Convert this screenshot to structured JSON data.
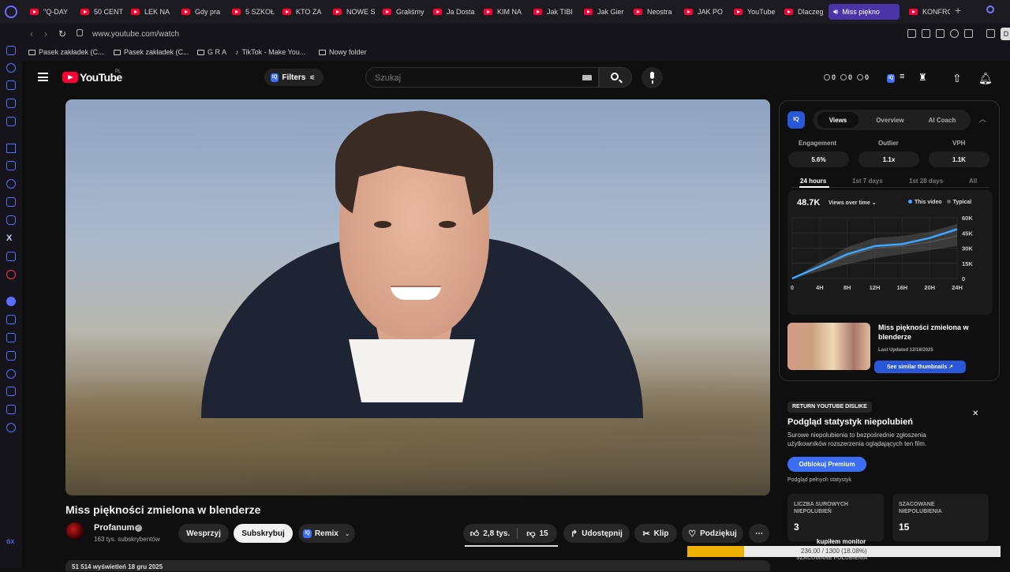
{
  "browser": {
    "tabs": [
      {
        "label": "\"Q-DAY",
        "icon": "youtube-icon"
      },
      {
        "label": "50 CENT",
        "icon": "youtube-icon"
      },
      {
        "label": "LEK NA",
        "icon": "youtube-icon"
      },
      {
        "label": "Gdy pra",
        "icon": "youtube-icon"
      },
      {
        "label": "5 SZKOŁ",
        "icon": "youtube-icon"
      },
      {
        "label": "KTO ZA",
        "icon": "youtube-icon"
      },
      {
        "label": "NOWE S",
        "icon": "youtube-icon"
      },
      {
        "label": "Graliśmy",
        "icon": "youtube-icon"
      },
      {
        "label": "Ja Dosta",
        "icon": "youtube-icon"
      },
      {
        "label": "KIM NA",
        "icon": "youtube-icon"
      },
      {
        "label": "Jak TIBI",
        "icon": "youtube-icon"
      },
      {
        "label": "Jak Gier",
        "icon": "youtube-icon"
      },
      {
        "label": "Neostra",
        "icon": "youtube-icon"
      },
      {
        "label": "JAK PO",
        "icon": "youtube-icon"
      },
      {
        "label": "YouTube",
        "icon": "youtube-icon"
      },
      {
        "label": "Dlaczeg",
        "icon": "youtube-icon"
      },
      {
        "label": "Miss piękno",
        "icon": "speaker-icon",
        "active": true
      },
      {
        "label": "KONFRO",
        "icon": "youtube-icon"
      }
    ],
    "url": "www.youtube.com/watch",
    "profile_initial": "D",
    "bookmarks": [
      {
        "label": "Pasek zakładek (C...",
        "icon": "folder-icon"
      },
      {
        "label": "Pasek zakładek (C...",
        "icon": "folder-icon"
      },
      {
        "label": "G R A",
        "icon": "folder-icon"
      },
      {
        "label": "TikTok - Make You...",
        "icon": "tiktok-icon"
      },
      {
        "label": "Nowy folder",
        "icon": "folder-icon"
      }
    ]
  },
  "header": {
    "logo_text": "YouTube",
    "region": "PL",
    "filters_label": "Filters",
    "search_placeholder": "Szukaj",
    "stats": [
      "0",
      "0",
      "0"
    ]
  },
  "video": {
    "title": "Miss piękności zmielona w blenderze",
    "channel": "Profanum",
    "subscribers": "163 tys. subskrybentów",
    "support_label": "Wesprzyj",
    "subscribe_label": "Subskrybuj",
    "remix_label": "Remix",
    "likes": "2,8 tys.",
    "dislikes": "15",
    "share_label": "Udostępnij",
    "clip_label": "Klip",
    "thanks_label": "Podziękuj",
    "meta": "51 514 wyświetleń  18 gru 2025"
  },
  "vidiq": {
    "tabs": [
      "Views",
      "Overview",
      "AI Coach"
    ],
    "active_tab": "Views",
    "metrics": [
      {
        "label": "Engagement",
        "value": "5.6%"
      },
      {
        "label": "Outlier",
        "value": "1.1x"
      },
      {
        "label": "VPH",
        "value": "1.1K"
      }
    ],
    "periods": [
      "24 hours",
      "1st 7 days",
      "1st 28 days",
      "All"
    ],
    "active_period": "24 hours",
    "views_total": "48.7K",
    "views_dropdown": "Views over time",
    "legend_this": "This video",
    "legend_typical": "Typical",
    "colors": {
      "this_video": "#3ea6ff",
      "typical": "#555555",
      "brand": "#2a56d8"
    },
    "thumbnail_title": "Miss piękności zmielona w blenderze",
    "thumbnail_date": "Last Updated 12/18/2025",
    "similar_label": "See similar thumbnails ↗"
  },
  "chart_data": {
    "type": "area",
    "x": [
      "0",
      "4H",
      "8H",
      "12H",
      "16H",
      "20H",
      "24H"
    ],
    "y_ticks": [
      "0",
      "15K",
      "30K",
      "45K",
      "60K"
    ],
    "ylim": [
      0,
      60000
    ],
    "series": [
      {
        "name": "This video",
        "values": [
          0,
          12000,
          24000,
          32000,
          34000,
          40000,
          48700
        ]
      },
      {
        "name": "Typical",
        "values": [
          0,
          11000,
          22000,
          30000,
          32000,
          36000,
          42000
        ]
      }
    ],
    "typical_band_low": [
      0,
      7000,
      14000,
      20000,
      24000,
      28000,
      32000
    ],
    "typical_band_high": [
      0,
      16000,
      31000,
      40000,
      42000,
      46000,
      54000
    ]
  },
  "ryd": {
    "badge": "RETURN YOUTUBE DISLIKE",
    "title": "Podgląd statystyk niepolubień",
    "description": "Surowe niepolubienia to bezpośrednie zgłoszenia użytkowników rozszerzenia oglądających ten film.",
    "premium_label": "Odblokuj Premium",
    "full_stats": "Podgląd pełnych statystyk",
    "cards": [
      {
        "label": "LICZBA SUROWYCH NIEPOLUBIEŃ",
        "value": "3"
      },
      {
        "label": "SZACOWANE NIEPOLUBIENIA",
        "value": "15"
      }
    ],
    "est_likes_label": "SZACOWANE POLUBIENIA"
  },
  "overlay": {
    "label": "kupiłem monitor",
    "progress_text": "236.00 / 1300 (18.08%)",
    "progress_fraction": 0.1808
  }
}
